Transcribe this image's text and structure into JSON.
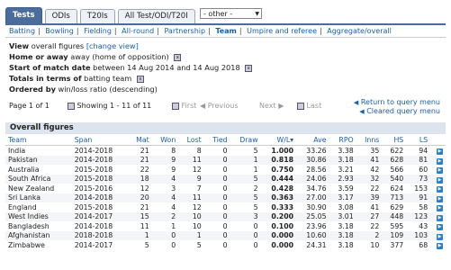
{
  "tabs": [
    {
      "label": "Tests",
      "active": true
    },
    {
      "label": "ODIs",
      "active": false
    },
    {
      "label": "T20Is",
      "active": false
    },
    {
      "label": "All Test/ODI/T20I",
      "active": false
    }
  ],
  "filter": {
    "value": "- other -"
  },
  "subnav": [
    "Batting",
    "Bowling",
    "Fielding",
    "All-round",
    "Partnership",
    "Team",
    "Umpire and referee",
    "Aggregate/overall"
  ],
  "info": {
    "view_label": "View",
    "view_text": "overall figures",
    "view_link": "[change view]",
    "home_label": "Home or away",
    "home_text": "away (home of opposition)",
    "start_label": "Start of match date",
    "start_text": "between 14 Aug 2014 and 14 Aug 2018",
    "totals_label": "Totals in terms of",
    "totals_text": "batting team",
    "order_label": "Ordered by",
    "order_text": "win/loss ratio (descending)"
  },
  "pager": {
    "page": "Page 1 of 1",
    "showing": "Showing 1 - 11 of 11",
    "first": "First",
    "previous": "Previous",
    "next": "Next",
    "last": "Last"
  },
  "links": {
    "return": "Return to query menu",
    "clear": "Cleared query menu"
  },
  "section_title": "Overall figures",
  "columns": [
    "Team",
    "Span",
    "Mat",
    "Won",
    "Lost",
    "Tied",
    "Draw",
    "W/L",
    "Ave",
    "RPO",
    "Inns",
    "HS",
    "LS"
  ],
  "rows": [
    [
      "India",
      "2014-2018",
      "21",
      "8",
      "8",
      "0",
      "5",
      "1.000",
      "33.26",
      "3.38",
      "35",
      "622",
      "94"
    ],
    [
      "Pakistan",
      "2014-2018",
      "21",
      "9",
      "11",
      "0",
      "1",
      "0.818",
      "30.86",
      "3.18",
      "41",
      "628",
      "81"
    ],
    [
      "Australia",
      "2015-2018",
      "22",
      "9",
      "12",
      "0",
      "1",
      "0.750",
      "28.56",
      "3.21",
      "42",
      "566",
      "60"
    ],
    [
      "South Africa",
      "2015-2018",
      "18",
      "4",
      "9",
      "0",
      "5",
      "0.444",
      "24.06",
      "2.93",
      "32",
      "540",
      "73"
    ],
    [
      "New Zealand",
      "2015-2016",
      "12",
      "3",
      "7",
      "0",
      "2",
      "0.428",
      "34.76",
      "3.59",
      "22",
      "624",
      "153"
    ],
    [
      "Sri Lanka",
      "2014-2018",
      "20",
      "4",
      "11",
      "0",
      "5",
      "0.363",
      "27.00",
      "3.17",
      "39",
      "713",
      "91"
    ],
    [
      "England",
      "2015-2018",
      "21",
      "4",
      "12",
      "0",
      "5",
      "0.333",
      "30.90",
      "3.08",
      "41",
      "629",
      "58"
    ],
    [
      "West Indies",
      "2014-2017",
      "15",
      "2",
      "10",
      "0",
      "3",
      "0.200",
      "25.05",
      "3.01",
      "27",
      "448",
      "123"
    ],
    [
      "Bangladesh",
      "2014-2018",
      "11",
      "1",
      "10",
      "0",
      "0",
      "0.100",
      "23.96",
      "3.18",
      "22",
      "595",
      "43"
    ],
    [
      "Afghanistan",
      "2018-2018",
      "1",
      "0",
      "1",
      "0",
      "0",
      "0.000",
      "10.60",
      "3.18",
      "2",
      "109",
      "103"
    ],
    [
      "Zimbabwe",
      "2014-2017",
      "5",
      "0",
      "5",
      "0",
      "0",
      "0.000",
      "24.31",
      "3.18",
      "10",
      "377",
      "68"
    ]
  ]
}
